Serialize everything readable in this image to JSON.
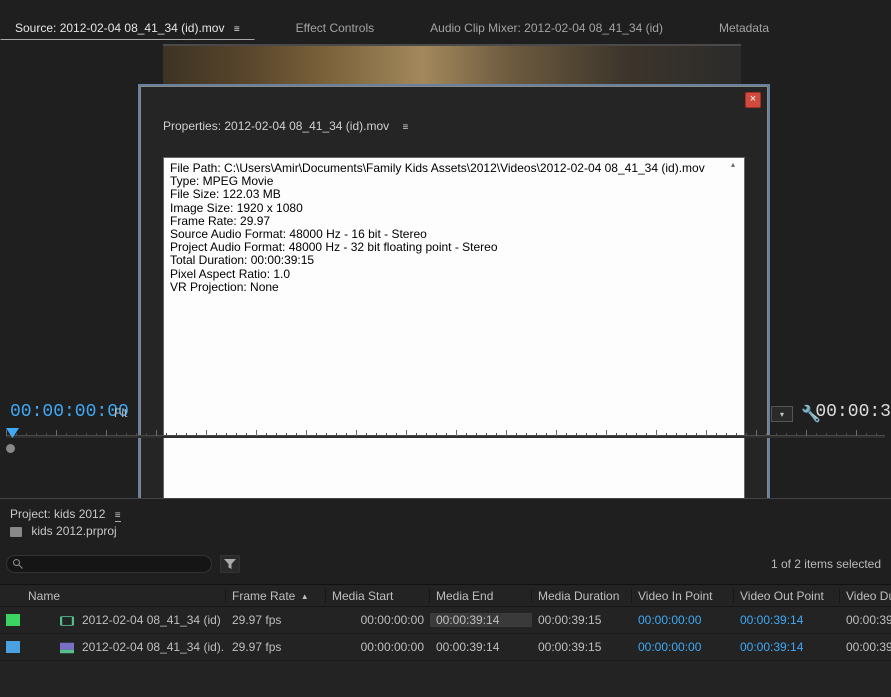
{
  "panel_tabs": {
    "source_label": "Source: 2012-02-04 08_41_34 (id).mov",
    "effect_controls": "Effect Controls",
    "audio_mixer": "Audio Clip Mixer: 2012-02-04 08_41_34 (id)",
    "metadata": "Metadata",
    "menu_glyph": "≡"
  },
  "modal": {
    "title": "Properties: 2012-02-04 08_41_34 (id).mov",
    "menu_glyph": "≡",
    "close_glyph": "×",
    "lines": [
      "File Path: C:\\Users\\Amir\\Documents\\Family Kids Assets\\2012\\Videos\\2012-02-04 08_41_34 (id).mov",
      "Type: MPEG Movie",
      "File Size: 122.03 MB",
      "Image Size: 1920 x 1080",
      "Frame Rate: 29.97",
      "Source Audio Format: 48000 Hz - 16 bit - Stereo",
      "Project Audio Format: 48000 Hz - 32 bit floating point - Stereo",
      "Total Duration: 00:00:39:15",
      "Pixel Aspect Ratio: 1.0",
      "VR Projection: None"
    ]
  },
  "timeline": {
    "left_tc": "00:00:00:00",
    "fit_label": "Fit",
    "right_tc": "00:00:3",
    "dd_glyph": "▾",
    "wrench_glyph": "🔧"
  },
  "project": {
    "title": "Project: kids 2012",
    "menu_glyph": "≡",
    "file_name": "kids 2012.prproj",
    "status": "1 of 2 items selected"
  },
  "table": {
    "headers": {
      "name": "Name",
      "frame_rate": "Frame Rate",
      "media_start": "Media Start",
      "media_end": "Media End",
      "media_duration": "Media Duration",
      "video_in": "Video In Point",
      "video_out": "Video Out Point",
      "video_du": "Video Du"
    },
    "sort_arrow": "▲",
    "rows": [
      {
        "swatch": "green",
        "name": "2012-02-04 08_41_34 (id)",
        "frame_rate": "29.97 fps",
        "media_start": "00:00:00:00",
        "media_end": "00:00:39:14",
        "media_duration": "00:00:39:15",
        "video_in": "00:00:00:00",
        "video_out": "00:00:39:14",
        "video_du": "00:00:39"
      },
      {
        "swatch": "blue",
        "name": "2012-02-04 08_41_34 (id).",
        "frame_rate": "29.97 fps",
        "media_start": "00:00:00:00",
        "media_end": "00:00:39:14",
        "media_duration": "00:00:39:15",
        "video_in": "00:00:00:00",
        "video_out": "00:00:39:14",
        "video_du": "00:00:39"
      }
    ]
  }
}
